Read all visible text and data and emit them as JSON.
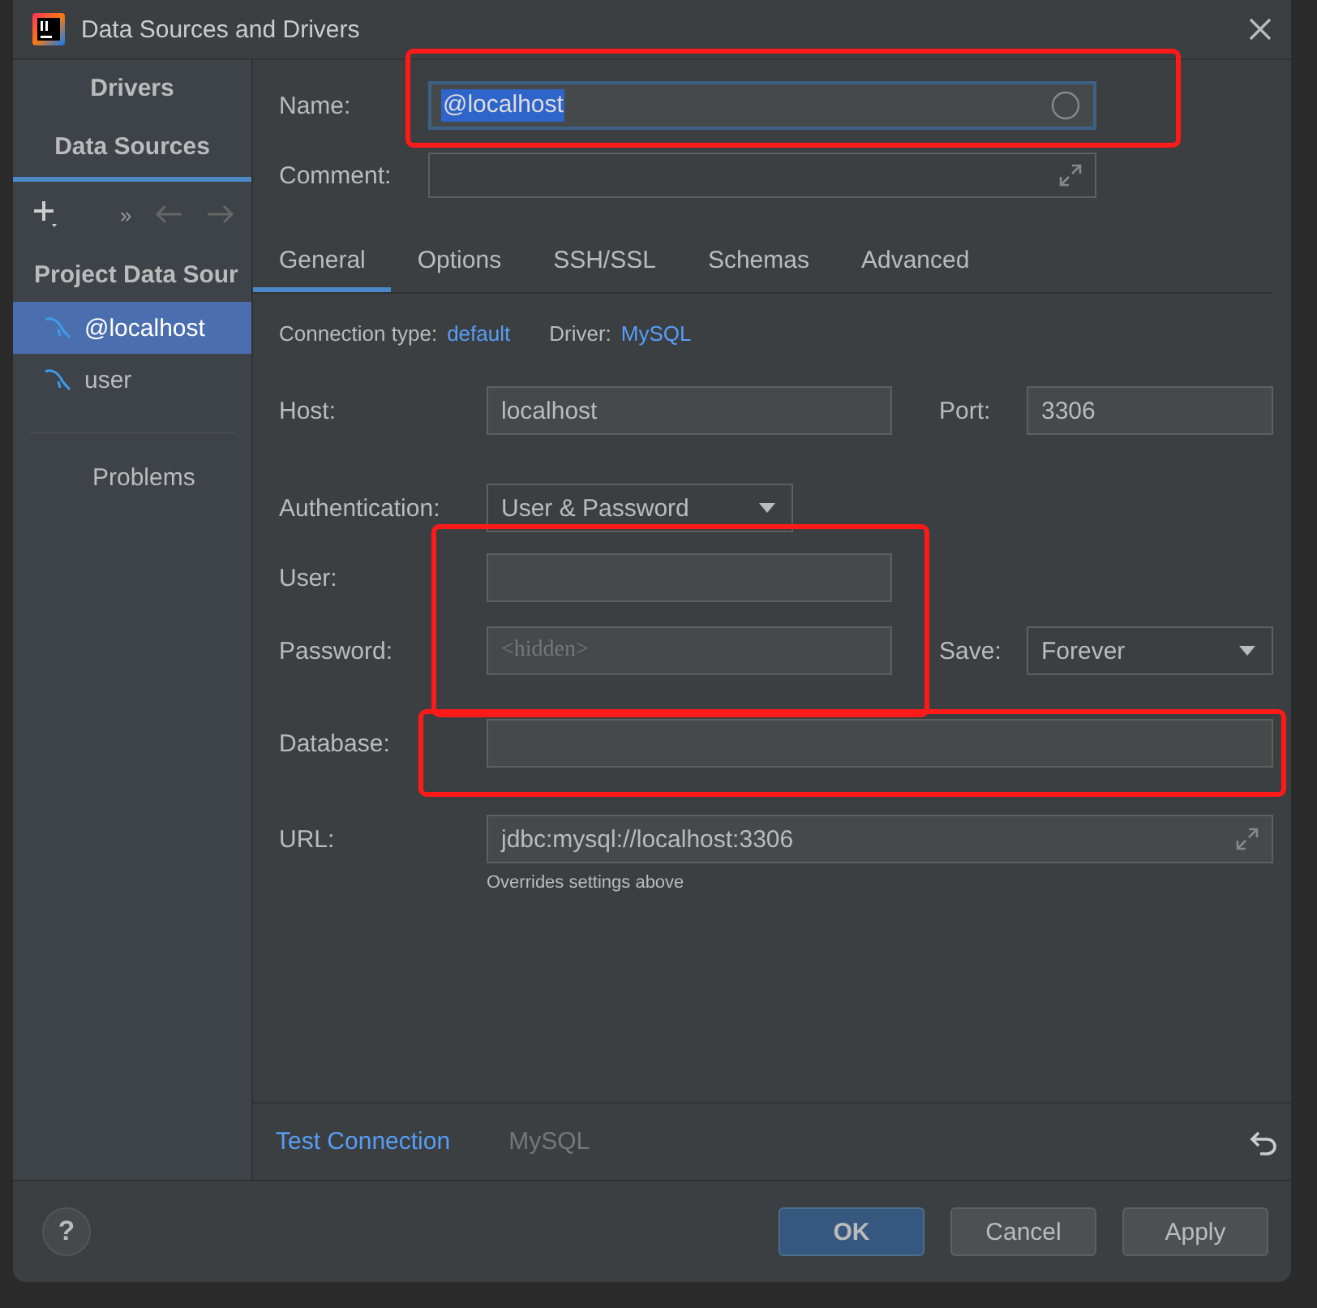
{
  "window": {
    "title": "Data Sources and Drivers"
  },
  "sidebar": {
    "tabs": [
      {
        "label": "Drivers",
        "selected": false
      },
      {
        "label": "Data Sources",
        "selected": true
      }
    ],
    "toolbar": {
      "more": "»"
    },
    "section": "Project Data Sour",
    "items": [
      {
        "label": "@localhost",
        "selected": true
      },
      {
        "label": "user",
        "selected": false
      }
    ],
    "problems": "Problems"
  },
  "form": {
    "name": {
      "label": "Name:",
      "value": "@localhost"
    },
    "comment": {
      "label": "Comment:"
    },
    "tabs": [
      {
        "label": "General",
        "selected": true
      },
      {
        "label": "Options",
        "selected": false
      },
      {
        "label": "SSH/SSL",
        "selected": false
      },
      {
        "label": "Schemas",
        "selected": false
      },
      {
        "label": "Advanced",
        "selected": false
      }
    ],
    "connection_type": {
      "label": "Connection type:",
      "value": "default"
    },
    "driver": {
      "label": "Driver:",
      "value": "MySQL"
    },
    "host": {
      "label": "Host:",
      "value": "localhost"
    },
    "port": {
      "label": "Port:",
      "value": "3306"
    },
    "authentication": {
      "label": "Authentication:",
      "value": "User & Password"
    },
    "user": {
      "label": "User:"
    },
    "password": {
      "label": "Password:",
      "placeholder": "<hidden>"
    },
    "save": {
      "label": "Save:",
      "value": "Forever"
    },
    "database": {
      "label": "Database:"
    },
    "url": {
      "label": "URL:",
      "value": "jdbc:mysql://localhost:3306",
      "note": "Overrides settings above"
    }
  },
  "bottom_bar": {
    "test_connection": "Test Connection",
    "driver": "MySQL"
  },
  "footer": {
    "help": "?",
    "buttons": [
      {
        "label": "OK",
        "default": true
      },
      {
        "label": "Cancel",
        "default": false
      },
      {
        "label": "Apply",
        "default": false
      }
    ]
  }
}
